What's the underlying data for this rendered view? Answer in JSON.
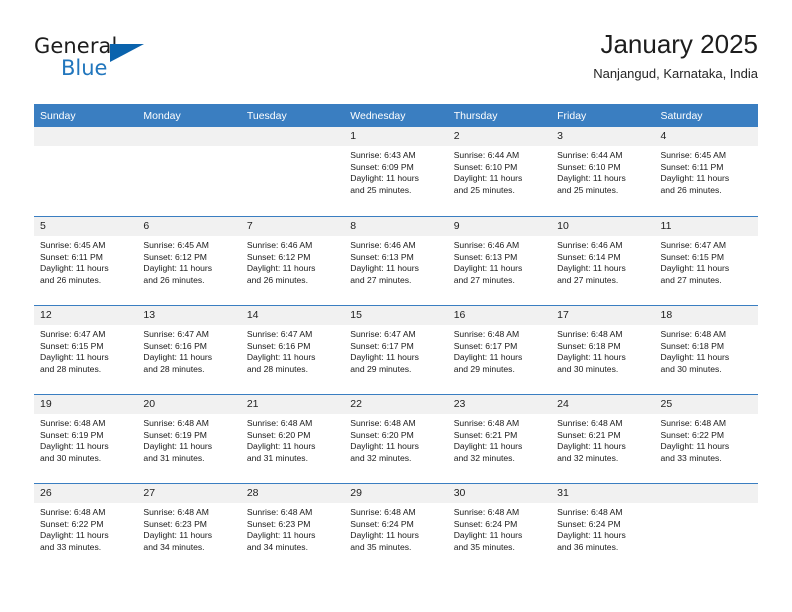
{
  "brand": {
    "name_part1": "General",
    "name_part2": "Blue",
    "flag_icon": "blue-triangle-logo",
    "color_primary": "#0a63ad",
    "color_accent": "#2176bd"
  },
  "header": {
    "title": "January 2025",
    "location": "Nanjangud, Karnataka, India"
  },
  "theme": {
    "header_row_bg": "#3a7ec1",
    "daynum_band_bg": "#f1f1f1",
    "grid_rule": "#3a7ec1",
    "text": "#1a1a1a"
  },
  "weekdays": [
    "Sunday",
    "Monday",
    "Tuesday",
    "Wednesday",
    "Thursday",
    "Friday",
    "Saturday"
  ],
  "weeks": [
    [
      {
        "day": "",
        "sunrise": "",
        "sunset": "",
        "daylight1": "",
        "daylight2": ""
      },
      {
        "day": "",
        "sunrise": "",
        "sunset": "",
        "daylight1": "",
        "daylight2": ""
      },
      {
        "day": "",
        "sunrise": "",
        "sunset": "",
        "daylight1": "",
        "daylight2": ""
      },
      {
        "day": "1",
        "sunrise": "Sunrise: 6:43 AM",
        "sunset": "Sunset: 6:09 PM",
        "daylight1": "Daylight: 11 hours",
        "daylight2": "and 25 minutes."
      },
      {
        "day": "2",
        "sunrise": "Sunrise: 6:44 AM",
        "sunset": "Sunset: 6:10 PM",
        "daylight1": "Daylight: 11 hours",
        "daylight2": "and 25 minutes."
      },
      {
        "day": "3",
        "sunrise": "Sunrise: 6:44 AM",
        "sunset": "Sunset: 6:10 PM",
        "daylight1": "Daylight: 11 hours",
        "daylight2": "and 25 minutes."
      },
      {
        "day": "4",
        "sunrise": "Sunrise: 6:45 AM",
        "sunset": "Sunset: 6:11 PM",
        "daylight1": "Daylight: 11 hours",
        "daylight2": "and 26 minutes."
      }
    ],
    [
      {
        "day": "5",
        "sunrise": "Sunrise: 6:45 AM",
        "sunset": "Sunset: 6:11 PM",
        "daylight1": "Daylight: 11 hours",
        "daylight2": "and 26 minutes."
      },
      {
        "day": "6",
        "sunrise": "Sunrise: 6:45 AM",
        "sunset": "Sunset: 6:12 PM",
        "daylight1": "Daylight: 11 hours",
        "daylight2": "and 26 minutes."
      },
      {
        "day": "7",
        "sunrise": "Sunrise: 6:46 AM",
        "sunset": "Sunset: 6:12 PM",
        "daylight1": "Daylight: 11 hours",
        "daylight2": "and 26 minutes."
      },
      {
        "day": "8",
        "sunrise": "Sunrise: 6:46 AM",
        "sunset": "Sunset: 6:13 PM",
        "daylight1": "Daylight: 11 hours",
        "daylight2": "and 27 minutes."
      },
      {
        "day": "9",
        "sunrise": "Sunrise: 6:46 AM",
        "sunset": "Sunset: 6:13 PM",
        "daylight1": "Daylight: 11 hours",
        "daylight2": "and 27 minutes."
      },
      {
        "day": "10",
        "sunrise": "Sunrise: 6:46 AM",
        "sunset": "Sunset: 6:14 PM",
        "daylight1": "Daylight: 11 hours",
        "daylight2": "and 27 minutes."
      },
      {
        "day": "11",
        "sunrise": "Sunrise: 6:47 AM",
        "sunset": "Sunset: 6:15 PM",
        "daylight1": "Daylight: 11 hours",
        "daylight2": "and 27 minutes."
      }
    ],
    [
      {
        "day": "12",
        "sunrise": "Sunrise: 6:47 AM",
        "sunset": "Sunset: 6:15 PM",
        "daylight1": "Daylight: 11 hours",
        "daylight2": "and 28 minutes."
      },
      {
        "day": "13",
        "sunrise": "Sunrise: 6:47 AM",
        "sunset": "Sunset: 6:16 PM",
        "daylight1": "Daylight: 11 hours",
        "daylight2": "and 28 minutes."
      },
      {
        "day": "14",
        "sunrise": "Sunrise: 6:47 AM",
        "sunset": "Sunset: 6:16 PM",
        "daylight1": "Daylight: 11 hours",
        "daylight2": "and 28 minutes."
      },
      {
        "day": "15",
        "sunrise": "Sunrise: 6:47 AM",
        "sunset": "Sunset: 6:17 PM",
        "daylight1": "Daylight: 11 hours",
        "daylight2": "and 29 minutes."
      },
      {
        "day": "16",
        "sunrise": "Sunrise: 6:48 AM",
        "sunset": "Sunset: 6:17 PM",
        "daylight1": "Daylight: 11 hours",
        "daylight2": "and 29 minutes."
      },
      {
        "day": "17",
        "sunrise": "Sunrise: 6:48 AM",
        "sunset": "Sunset: 6:18 PM",
        "daylight1": "Daylight: 11 hours",
        "daylight2": "and 30 minutes."
      },
      {
        "day": "18",
        "sunrise": "Sunrise: 6:48 AM",
        "sunset": "Sunset: 6:18 PM",
        "daylight1": "Daylight: 11 hours",
        "daylight2": "and 30 minutes."
      }
    ],
    [
      {
        "day": "19",
        "sunrise": "Sunrise: 6:48 AM",
        "sunset": "Sunset: 6:19 PM",
        "daylight1": "Daylight: 11 hours",
        "daylight2": "and 30 minutes."
      },
      {
        "day": "20",
        "sunrise": "Sunrise: 6:48 AM",
        "sunset": "Sunset: 6:19 PM",
        "daylight1": "Daylight: 11 hours",
        "daylight2": "and 31 minutes."
      },
      {
        "day": "21",
        "sunrise": "Sunrise: 6:48 AM",
        "sunset": "Sunset: 6:20 PM",
        "daylight1": "Daylight: 11 hours",
        "daylight2": "and 31 minutes."
      },
      {
        "day": "22",
        "sunrise": "Sunrise: 6:48 AM",
        "sunset": "Sunset: 6:20 PM",
        "daylight1": "Daylight: 11 hours",
        "daylight2": "and 32 minutes."
      },
      {
        "day": "23",
        "sunrise": "Sunrise: 6:48 AM",
        "sunset": "Sunset: 6:21 PM",
        "daylight1": "Daylight: 11 hours",
        "daylight2": "and 32 minutes."
      },
      {
        "day": "24",
        "sunrise": "Sunrise: 6:48 AM",
        "sunset": "Sunset: 6:21 PM",
        "daylight1": "Daylight: 11 hours",
        "daylight2": "and 32 minutes."
      },
      {
        "day": "25",
        "sunrise": "Sunrise: 6:48 AM",
        "sunset": "Sunset: 6:22 PM",
        "daylight1": "Daylight: 11 hours",
        "daylight2": "and 33 minutes."
      }
    ],
    [
      {
        "day": "26",
        "sunrise": "Sunrise: 6:48 AM",
        "sunset": "Sunset: 6:22 PM",
        "daylight1": "Daylight: 11 hours",
        "daylight2": "and 33 minutes."
      },
      {
        "day": "27",
        "sunrise": "Sunrise: 6:48 AM",
        "sunset": "Sunset: 6:23 PM",
        "daylight1": "Daylight: 11 hours",
        "daylight2": "and 34 minutes."
      },
      {
        "day": "28",
        "sunrise": "Sunrise: 6:48 AM",
        "sunset": "Sunset: 6:23 PM",
        "daylight1": "Daylight: 11 hours",
        "daylight2": "and 34 minutes."
      },
      {
        "day": "29",
        "sunrise": "Sunrise: 6:48 AM",
        "sunset": "Sunset: 6:24 PM",
        "daylight1": "Daylight: 11 hours",
        "daylight2": "and 35 minutes."
      },
      {
        "day": "30",
        "sunrise": "Sunrise: 6:48 AM",
        "sunset": "Sunset: 6:24 PM",
        "daylight1": "Daylight: 11 hours",
        "daylight2": "and 35 minutes."
      },
      {
        "day": "31",
        "sunrise": "Sunrise: 6:48 AM",
        "sunset": "Sunset: 6:24 PM",
        "daylight1": "Daylight: 11 hours",
        "daylight2": "and 36 minutes."
      },
      {
        "day": "",
        "sunrise": "",
        "sunset": "",
        "daylight1": "",
        "daylight2": ""
      }
    ]
  ]
}
